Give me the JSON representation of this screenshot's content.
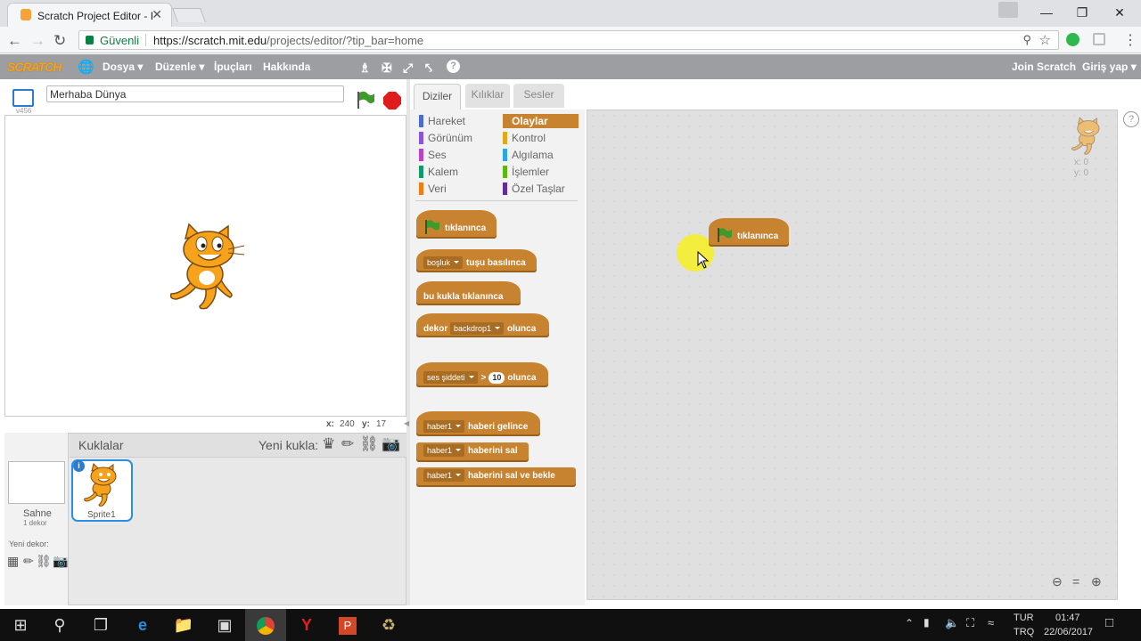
{
  "browser": {
    "tab_title": "Scratch Project Editor - Im",
    "tab_close": "✕",
    "security_label": "Güvenli",
    "url_host": "https://scratch.mit.edu",
    "url_path": "/projects/editor/?tip_bar=home"
  },
  "menu": {
    "logo": "SCRATCH",
    "file": "Dosya ▾",
    "edit": "Düzenle ▾",
    "tips": "İpuçları",
    "about": "Hakkında",
    "join": "Join Scratch",
    "signin": "Giriş yap ▾"
  },
  "stage": {
    "project_name": "Merhaba Dünya",
    "version": "v456",
    "x_label": "x:",
    "x_value": "240",
    "y_label": "y:",
    "y_value": "17"
  },
  "sprites": {
    "header": "Kuklalar",
    "new_sprite": "Yeni kukla:",
    "stage_label": "Sahne",
    "stage_count": "1 dekor",
    "new_backdrop": "Yeni dekor:",
    "sprite1": "Sprite1"
  },
  "tabs": {
    "scripts": "Diziler",
    "costumes": "Kılıklar",
    "sounds": "Sesler"
  },
  "categories": [
    {
      "label": "Hareket",
      "color": "#4a6cd4"
    },
    {
      "label": "Görünüm",
      "color": "#8a55d7"
    },
    {
      "label": "Ses",
      "color": "#bb42c3"
    },
    {
      "label": "Kalem",
      "color": "#0e9a6c"
    },
    {
      "label": "Veri",
      "color": "#ee7d16"
    },
    {
      "label": "Olaylar",
      "color": "#c88330"
    },
    {
      "label": "Kontrol",
      "color": "#e1a91a"
    },
    {
      "label": "Algılama",
      "color": "#2ca5e2"
    },
    {
      "label": "İşlemler",
      "color": "#5cb712"
    },
    {
      "label": "Özel Taşlar",
      "color": "#632d99"
    }
  ],
  "blocks": {
    "flag_clicked": "tıklanınca",
    "key_dd": "boşluk",
    "key_text": "tuşu basılınca",
    "sprite_clicked": "bu kukla tıklanınca",
    "backdrop_pre": "dekor",
    "backdrop_dd": "backdrop1",
    "backdrop_post": "olunca",
    "loud_dd": "ses şiddeti",
    "loud_gt": ">",
    "loud_num": "10",
    "loud_post": "olunca",
    "msg_dd": "haber1",
    "receive": "haberi gelince",
    "broadcast": "haberini sal",
    "broadcast_wait": "haberini sal ve bekle"
  },
  "script_area": {
    "placed_block": "tıklanınca",
    "sprite_x": "x: 0",
    "sprite_y": "y: 0"
  },
  "taskbar": {
    "lang": "TUR",
    "lang2": "TRQ",
    "time": "01:47",
    "date": "22/06/2017"
  }
}
